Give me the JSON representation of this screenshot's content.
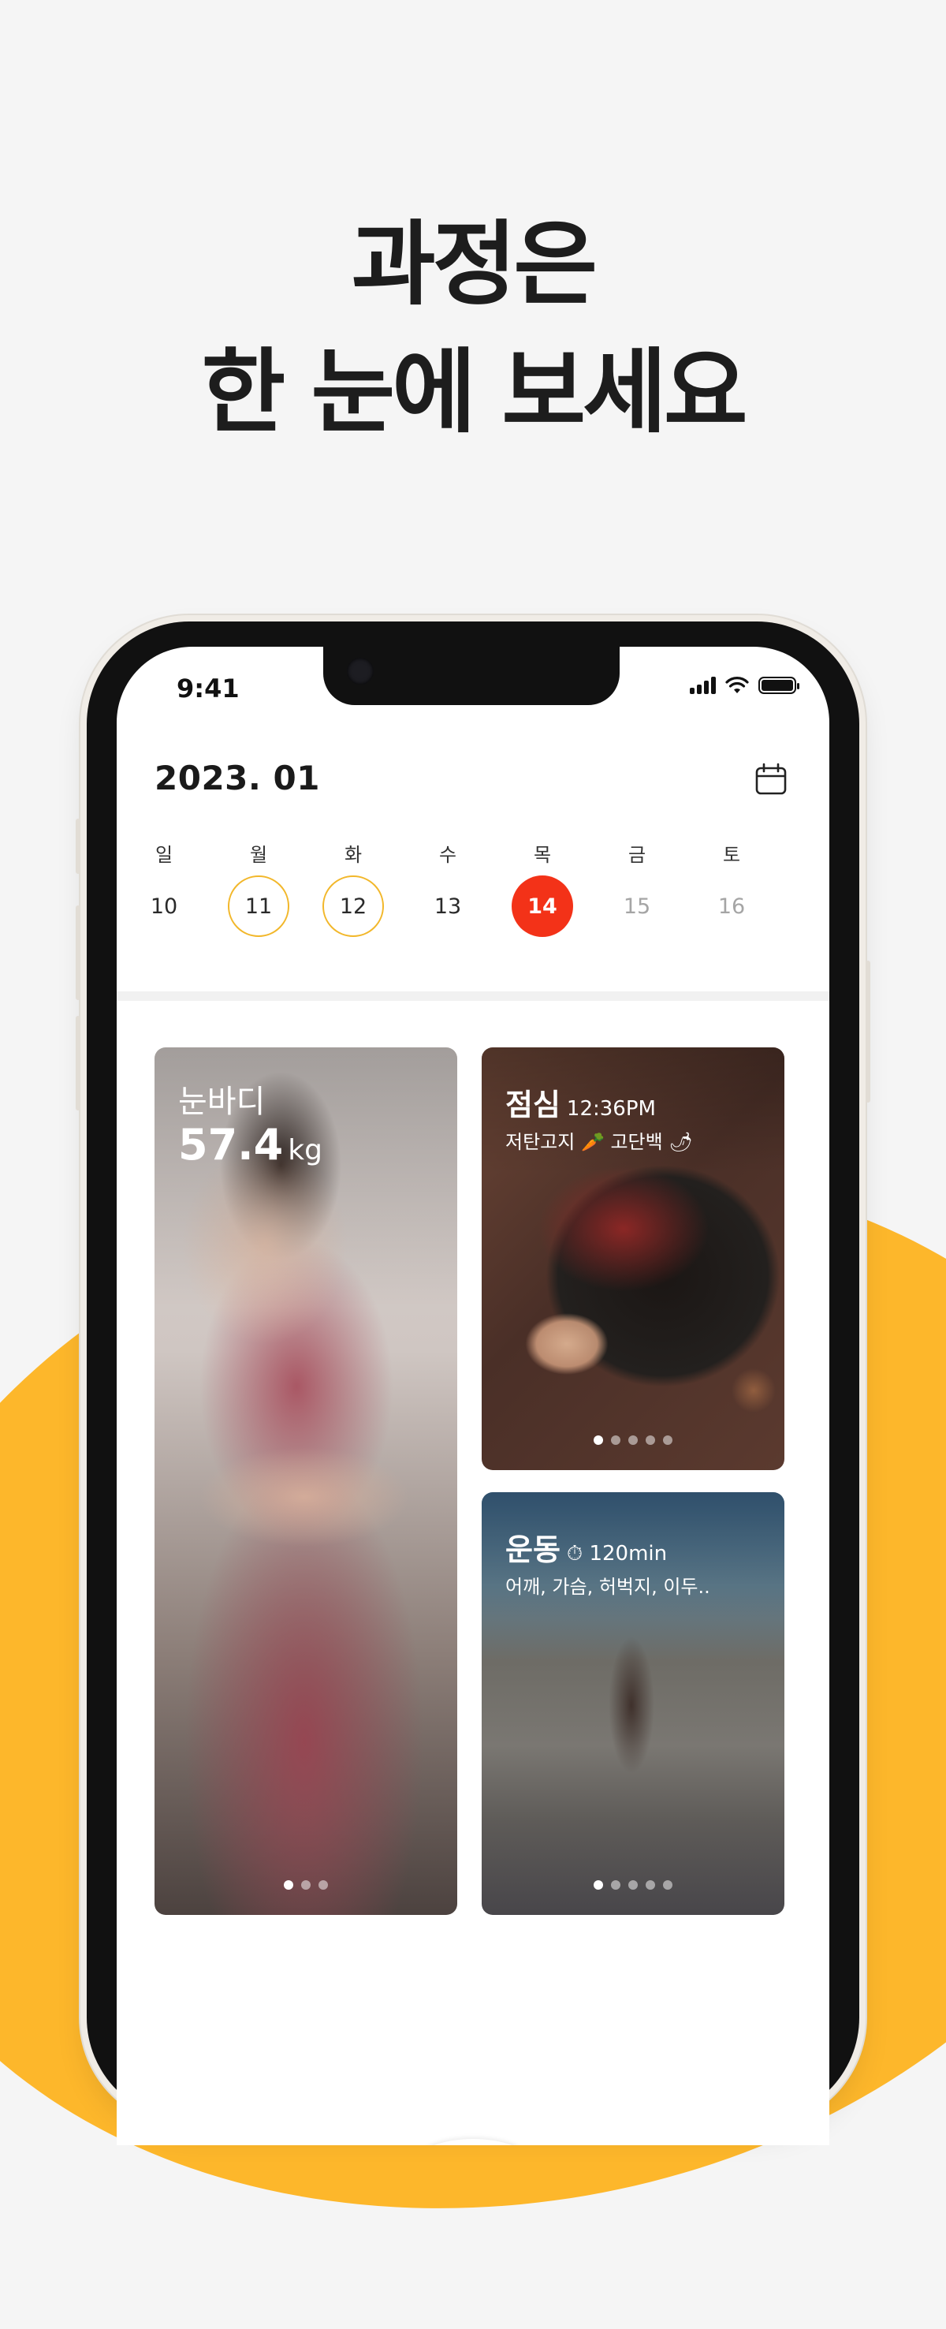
{
  "headline": {
    "line1": "과정은",
    "line2": "한 눈에 보세요"
  },
  "status_bar": {
    "time": "9:41"
  },
  "calendar": {
    "month_label": "2023. 01",
    "weekdays": [
      "일",
      "월",
      "화",
      "수",
      "목",
      "금",
      "토"
    ],
    "days": [
      {
        "label": "10",
        "state": "normal"
      },
      {
        "label": "11",
        "state": "recorded"
      },
      {
        "label": "12",
        "state": "recorded"
      },
      {
        "label": "13",
        "state": "normal"
      },
      {
        "label": "14",
        "state": "selected"
      },
      {
        "label": "15",
        "state": "future"
      },
      {
        "label": "16",
        "state": "future"
      }
    ]
  },
  "cards": {
    "body": {
      "title": "눈바디",
      "value": "57.4",
      "unit": "kg",
      "page_count": 3,
      "active_page": 1
    },
    "meal": {
      "title": "점심",
      "time": "12:36PM",
      "tags": "저탄고지 🥕 고단백 🌶",
      "page_count": 5,
      "active_page": 1
    },
    "workout": {
      "title": "운동",
      "duration": "⏱ 120min",
      "parts": "어깨, 가슴, 허벅지, 이두..",
      "page_count": 5,
      "active_page": 1
    }
  },
  "colors": {
    "accent_yellow": "#fdb72b",
    "selected_red": "#f33218",
    "ring_yellow": "#f2b72a"
  }
}
